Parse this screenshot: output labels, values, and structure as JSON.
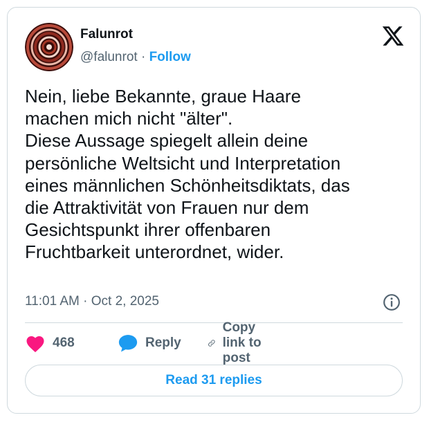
{
  "author": {
    "name": "Falunrot",
    "handle": "@falunrot",
    "separator": "·",
    "follow_label": "Follow"
  },
  "tweet": {
    "text": "Nein, liebe Bekannte, graue Haare\nmachen mich nicht \"älter\".\nDiese Aussage spiegelt allein deine\npersönliche Weltsicht und Interpretation\neines männlichen Schönheitsdiktats, das\ndie Attraktivität von Frauen nur dem\nGesichtspunkt ihrer offenbaren\nFruchtbarkeit unterordnet, wider.",
    "timestamp": "11:01 AM · Oct 2, 2025"
  },
  "actions": {
    "like_count": "468",
    "reply_label": "Reply",
    "copy_label": "Copy link to post"
  },
  "read_replies_label": "Read 31 replies",
  "icons": {
    "platform": "x-logo-icon",
    "info": "info-icon",
    "like": "heart-icon",
    "reply": "speech-bubble-icon",
    "copy": "link-icon"
  },
  "colors": {
    "accent": "#1d9bf0",
    "like": "#f91880",
    "muted": "#536471",
    "text": "#0f1419",
    "border": "#cfd9de"
  }
}
